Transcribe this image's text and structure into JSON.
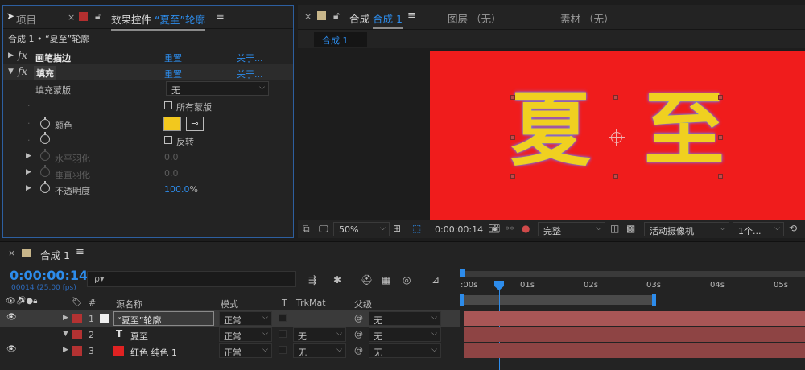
{
  "left_panel": {
    "tab_project": "项目",
    "tab_effect_prefix": "效果控件",
    "tab_effect_layer": "“夏至”轮廓",
    "subtitle": "合成 1 • “夏至”轮廓",
    "effects": [
      {
        "fx": "fx",
        "name": "画笔描边",
        "reset": "重置",
        "about": "关于..."
      },
      {
        "fx": "fx",
        "name": "填充",
        "reset": "重置",
        "about": "关于..."
      }
    ],
    "fill_mask_label": "填充蒙版",
    "fill_mask_value": "无",
    "all_masks_label": "所有蒙版",
    "color_label": "颜色",
    "color_value": "#f2c81e",
    "invert_label": "反转",
    "h_feather_label": "水平羽化",
    "h_feather_value": "0.0",
    "v_feather_label": "垂直羽化",
    "v_feather_value": "0.0",
    "opacity_label": "不透明度",
    "opacity_value": "100.0",
    "opacity_unit": "%"
  },
  "comp_panel": {
    "tab_comp": "合成",
    "tab_comp_name": "合成 1",
    "tab_layer": "图层 （无）",
    "tab_footage": "素材 （无）",
    "comp_chip": "合成 1",
    "canvas_chars": [
      "夏",
      "至"
    ],
    "toolbar": {
      "zoom": "50%",
      "timecode": "0:00:00:14",
      "resolution": "完整",
      "camera": "活动摄像机",
      "views": "1个..."
    }
  },
  "timeline": {
    "tab_name": "合成 1",
    "timecode": "0:00:00:14",
    "frame_info": "00014 (25.00 fps)",
    "search_placeholder": "ρ▾",
    "ruler": [
      ":00s",
      "01s",
      "02s",
      "03s",
      "04s",
      "05s"
    ],
    "columns": {
      "hash": "#",
      "source": "源名称",
      "mode": "模式",
      "t": "T",
      "trkmat": "TrkMat",
      "parent": "父级"
    },
    "layers": [
      {
        "num": "1",
        "name": "“夏至”轮廓",
        "mode": "正常",
        "trkmat": "",
        "parent": "无"
      },
      {
        "num": "2",
        "name": "夏至",
        "mode": "正常",
        "trkmat": "无",
        "parent": "无"
      },
      {
        "num": "3",
        "name": "红色 纯色 1",
        "mode": "正常",
        "trkmat": "无",
        "parent": "无"
      }
    ]
  }
}
